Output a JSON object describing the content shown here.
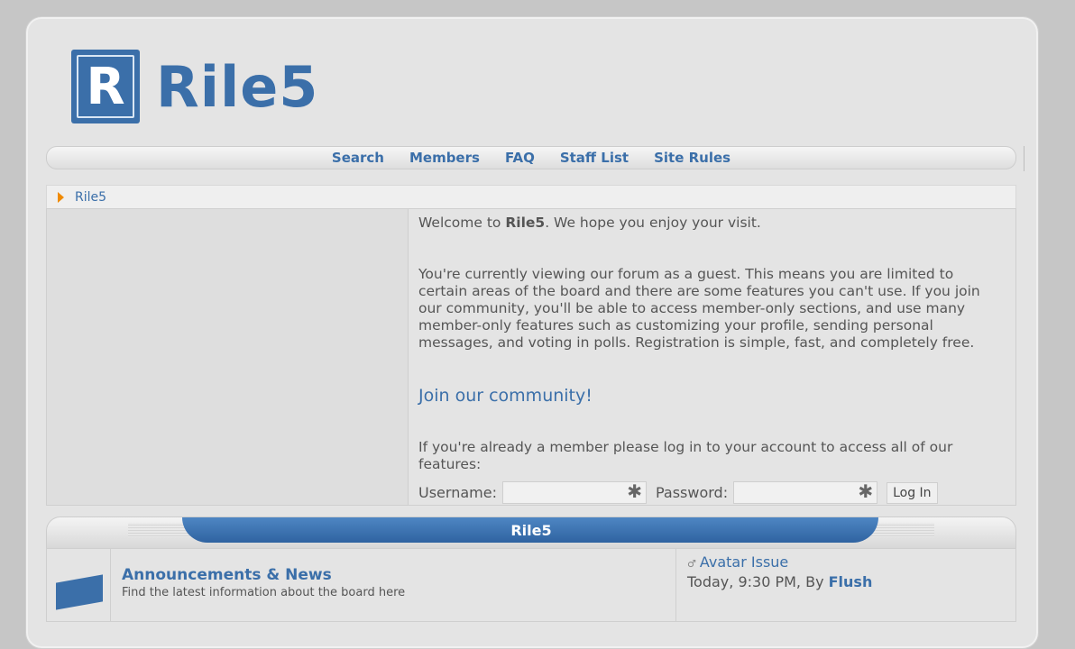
{
  "brand": {
    "logo_letter": "R",
    "name": "Rile5",
    "color": "#3b6fa9"
  },
  "nav": [
    "Search",
    "Members",
    "FAQ",
    "Staff List",
    "Site Rules"
  ],
  "breadcrumb": {
    "item": "Rile5"
  },
  "welcome": {
    "line_pre": "Welcome to ",
    "line_bold": "Rile5",
    "line_post": ". We hope you enjoy your visit.",
    "guest_text": "You're currently viewing our forum as a guest. This means you are limited to certain areas of the board and there are some features you can't use. If you join our community, you'll be able to access member-only sections, and use many member-only features such as customizing your profile, sending personal messages, and voting in polls. Registration is simple, fast, and completely free.",
    "join_link": "Join our community!",
    "member_text": "If you're already a member please log in to your account to access all of our features:",
    "username_label": "Username:",
    "password_label": "Password:",
    "login_button": "Log In"
  },
  "category": {
    "title": "Rile5",
    "forum": {
      "name": "Announcements & News",
      "description": "Find the latest information about the board here",
      "last_topic": "Avatar Issue",
      "last_time": "Today, 9:30 PM, By ",
      "last_user": "Flush"
    }
  }
}
